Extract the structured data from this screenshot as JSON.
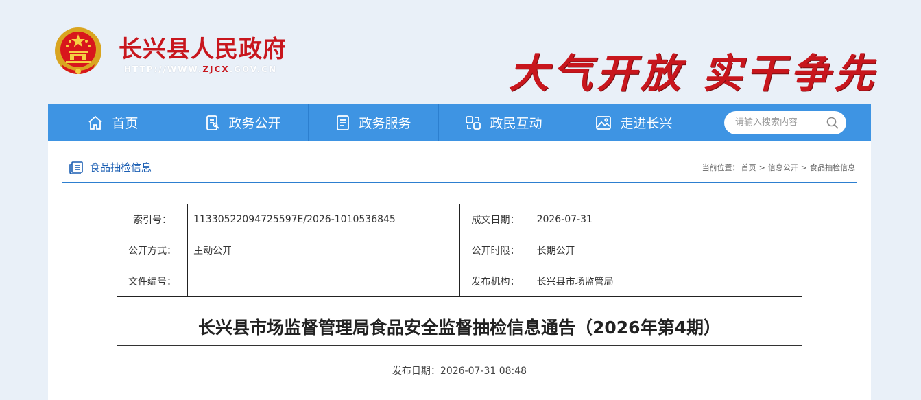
{
  "header": {
    "site_title": "长兴县人民政府",
    "site_url_prefix": "HTTP://WWW.",
    "site_url_highlight": "ZJCX",
    "site_url_suffix": ".GOV.CN",
    "slogan": "大气开放 实干争先",
    "emblem_icon": "national-emblem-icon"
  },
  "nav": {
    "items": [
      {
        "label": "首页",
        "icon": "home-icon"
      },
      {
        "label": "政务公开",
        "icon": "document-icon"
      },
      {
        "label": "政务服务",
        "icon": "list-document-icon"
      },
      {
        "label": "政民互动",
        "icon": "interaction-icon"
      },
      {
        "label": "走进长兴",
        "icon": "picture-icon"
      }
    ],
    "search_placeholder": "请输入搜索内容"
  },
  "section": {
    "title": "食品抽检信息",
    "breadcrumb_prefix": "当前位置：",
    "breadcrumb": [
      "首页",
      "信息公开",
      "食品抽检信息"
    ],
    "separator": ">"
  },
  "info_table": {
    "rows": [
      {
        "k1": "索引号：",
        "v1": "11330522094725597E/2026-1010536845",
        "k2": "成文日期：",
        "v2": "2026-07-31"
      },
      {
        "k1": "公开方式：",
        "v1": "主动公开",
        "k2": "公开时限：",
        "v2": "长期公开"
      },
      {
        "k1": "文件编号：",
        "v1": "",
        "k2": "发布机构：",
        "v2": "长兴县市场监管局"
      }
    ]
  },
  "article": {
    "title": "长兴县市场监督管理局食品安全监督抽检信息通告（2026年第4期）",
    "pub_date_label": "发布日期：",
    "pub_date": "2026-07-31 08:48"
  },
  "colors": {
    "brand_red": "#c8161d",
    "nav_blue": "#3e94e3",
    "accent_blue": "#2d7fd0",
    "page_bg": "#e9f0f8"
  }
}
